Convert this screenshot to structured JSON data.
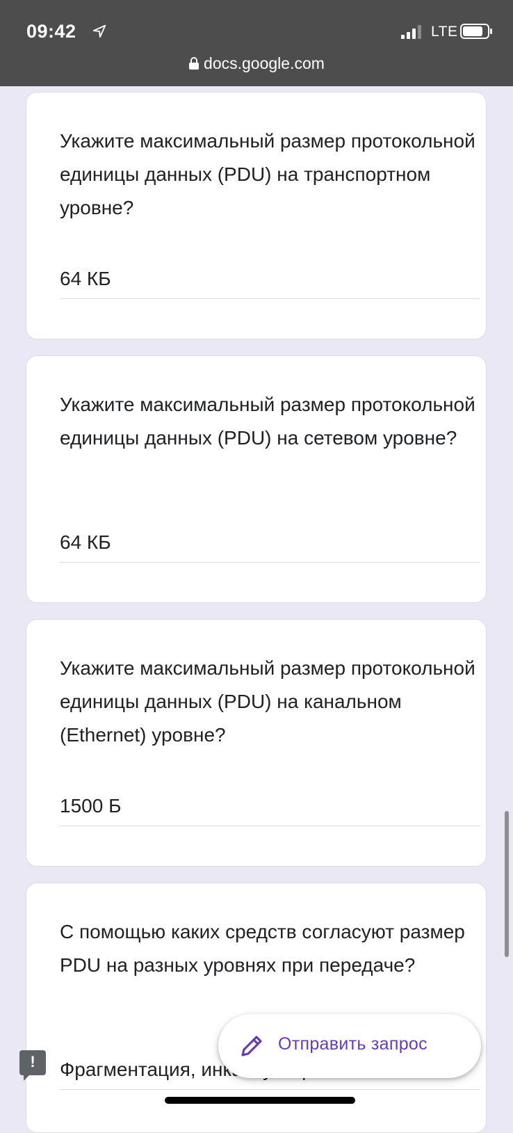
{
  "status_bar": {
    "time": "09:42",
    "network": "LTE"
  },
  "browser": {
    "url": "docs.google.com"
  },
  "questions": [
    {
      "text": "Укажите максимальный размер протокольной единицы данных (PDU) на транспортном уровне?",
      "answer": "64 КБ"
    },
    {
      "text": "Укажите максимальный размер протокольной единицы данных (PDU) на сетевом уровне?",
      "answer": "64 КБ"
    },
    {
      "text": "Укажите максимальный размер протокольной единицы данных (PDU) на канальном (Ethernet) уровне?",
      "answer": "1500 Б"
    },
    {
      "text": "С помощью каких средств согласуют размер PDU на разных уровнях при передаче?",
      "answer": "Фрагментация, инкапсуляция"
    }
  ],
  "fab": {
    "label": "Отправить запрос",
    "icon": "pencil-icon"
  },
  "colors": {
    "background": "#ebe8f5",
    "accent": "#673ab7",
    "topbar": "#4d4d4d"
  }
}
